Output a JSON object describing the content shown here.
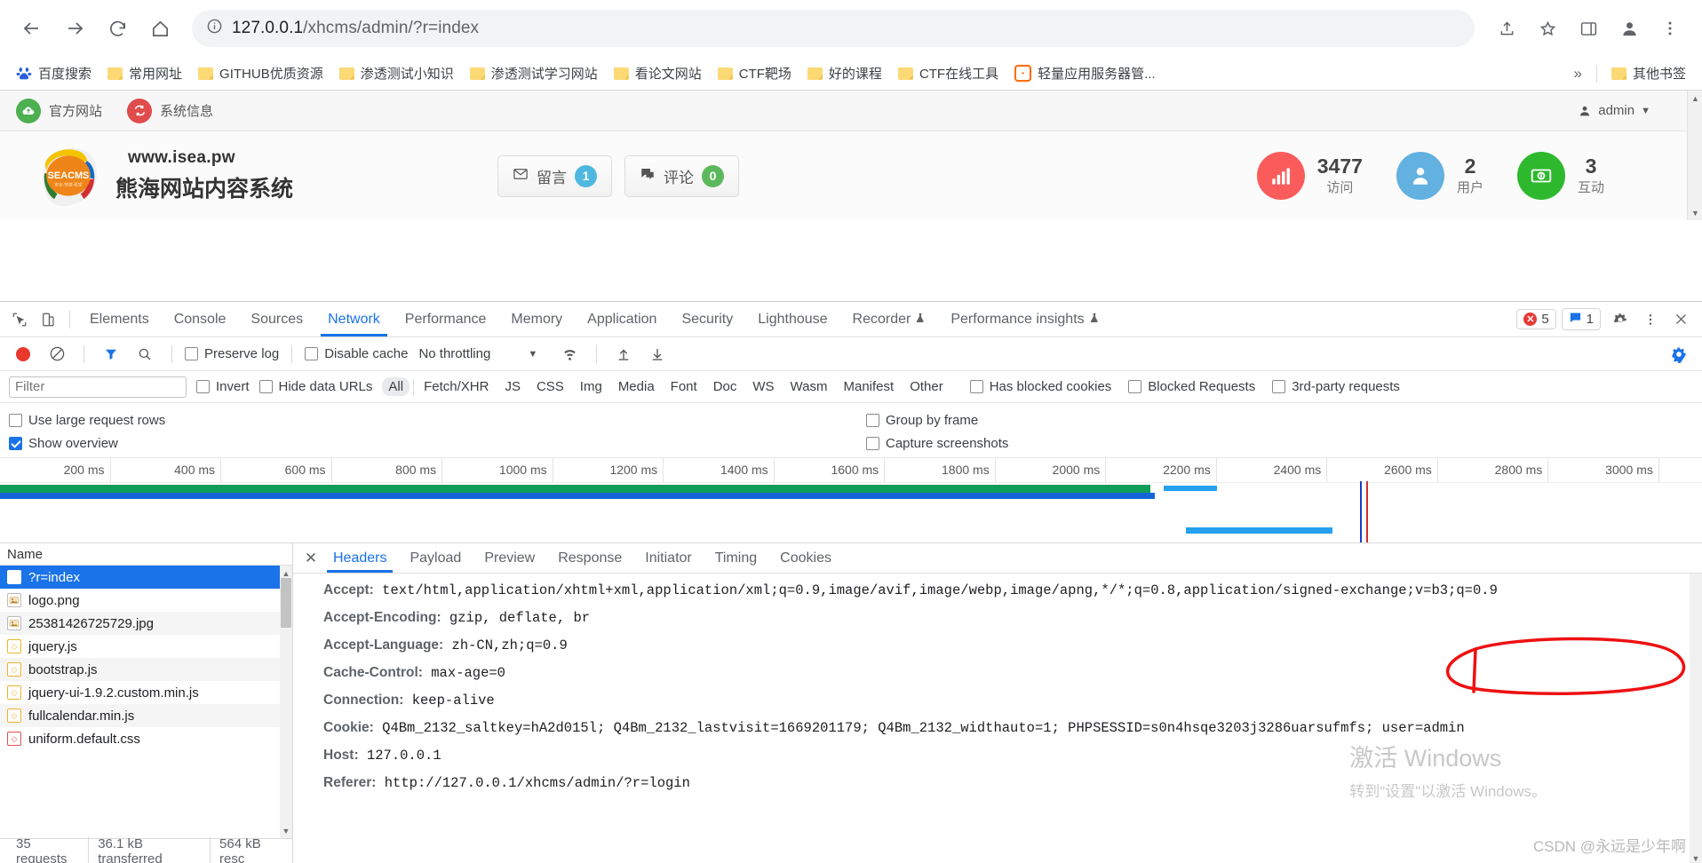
{
  "browser": {
    "url_host": "127.0.0.1",
    "url_path": "/xhcms/admin/?r=index",
    "back_icon": "back-arrow-icon",
    "forward_icon": "forward-arrow-icon",
    "reload_icon": "reload-icon",
    "home_icon": "home-icon",
    "info_icon": "site-info-icon",
    "share_icon": "share-icon",
    "star_icon": "bookmark-star-icon",
    "sidepanel_icon": "side-panel-icon",
    "profile_icon": "profile-avatar-icon",
    "menu_icon": "kebab-menu-icon"
  },
  "bookmarks": {
    "items": [
      {
        "label": "百度搜索",
        "icon": "baidu-icon"
      },
      {
        "label": "常用网址",
        "icon": "folder-icon"
      },
      {
        "label": "GITHUB优质资源",
        "icon": "folder-icon"
      },
      {
        "label": "渗透测试小知识",
        "icon": "folder-icon"
      },
      {
        "label": "渗透测试学习网站",
        "icon": "folder-icon"
      },
      {
        "label": "看论文网站",
        "icon": "folder-icon"
      },
      {
        "label": "CTF靶场",
        "icon": "folder-icon"
      },
      {
        "label": "好的课程",
        "icon": "folder-icon"
      },
      {
        "label": "CTF在线工具",
        "icon": "folder-icon"
      },
      {
        "label": "轻量应用服务器管...",
        "icon": "lighthouse-icon"
      }
    ],
    "overflow_label": "»",
    "other_label": "其他书签"
  },
  "cms": {
    "topbar": {
      "official_site": "官方网站",
      "system_info": "系统信息",
      "user": "admin"
    },
    "brand": {
      "logo_text": "SEACMS",
      "site_url": "www.isea.pw",
      "site_name": "熊海网站内容系统"
    },
    "msg_buttons": [
      {
        "label": "留言",
        "count": "1",
        "color": "#4fb8e0",
        "icon": "envelope-icon"
      },
      {
        "label": "评论",
        "count": "0",
        "color": "#5cb85c",
        "icon": "comment-icon"
      }
    ],
    "stats": [
      {
        "value": "3477",
        "label": "访问",
        "color": "#fa5c5c",
        "icon": "bar-chart-icon"
      },
      {
        "value": "2",
        "label": "用户",
        "color": "#62b1e0",
        "icon": "user-icon"
      },
      {
        "value": "3",
        "label": "互动",
        "color": "#2eb82e",
        "icon": "money-icon"
      }
    ]
  },
  "devtools": {
    "tabs": [
      {
        "label": "Elements",
        "active": false
      },
      {
        "label": "Console",
        "active": false
      },
      {
        "label": "Sources",
        "active": false
      },
      {
        "label": "Network",
        "active": true
      },
      {
        "label": "Performance",
        "active": false
      },
      {
        "label": "Memory",
        "active": false
      },
      {
        "label": "Application",
        "active": false
      },
      {
        "label": "Security",
        "active": false
      },
      {
        "label": "Lighthouse",
        "active": false
      },
      {
        "label": "Recorder",
        "active": false,
        "experiment": true
      },
      {
        "label": "Performance insights",
        "active": false,
        "experiment": true
      }
    ],
    "error_count": "5",
    "message_count": "1",
    "inspect_icon": "inspect-element-icon",
    "device_icon": "device-toolbar-icon",
    "settings_icon": "gear-icon",
    "more_icon": "kebab-menu-icon",
    "close_icon": "close-icon",
    "network_toolbar": {
      "record_icon": "record-icon",
      "clear_icon": "clear-icon",
      "filter_icon": "filter-icon",
      "search_icon": "search-icon",
      "preserve_log": "Preserve log",
      "preserve_log_checked": false,
      "disable_cache": "Disable cache",
      "disable_cache_checked": false,
      "throttling": "No throttling",
      "wifi_icon": "network-conditions-icon",
      "import_icon": "import-har-icon",
      "export_icon": "export-har-icon",
      "settings_icon": "gear-icon"
    },
    "filter_bar": {
      "placeholder": "Filter",
      "value": "",
      "invert": "Invert",
      "invert_checked": false,
      "hide_data_urls": "Hide data URLs",
      "hide_data_urls_checked": false,
      "types": [
        "All",
        "Fetch/XHR",
        "JS",
        "CSS",
        "Img",
        "Media",
        "Font",
        "Doc",
        "WS",
        "Wasm",
        "Manifest",
        "Other"
      ],
      "selected_type": "All",
      "has_blocked_cookies": "Has blocked cookies",
      "has_blocked_cookies_checked": false,
      "blocked_requests": "Blocked Requests",
      "blocked_requests_checked": false,
      "third_party": "3rd-party requests",
      "third_party_checked": false
    },
    "options": {
      "large_rows": "Use large request rows",
      "large_rows_checked": false,
      "show_overview": "Show overview",
      "show_overview_checked": true,
      "group_by_frame": "Group by frame",
      "group_by_frame_checked": false,
      "capture_screenshots": "Capture screenshots",
      "capture_screenshots_checked": false
    },
    "overview_ticks": [
      "200 ms",
      "400 ms",
      "600 ms",
      "800 ms",
      "1000 ms",
      "1200 ms",
      "1400 ms",
      "1600 ms",
      "1800 ms",
      "2000 ms",
      "2200 ms",
      "2400 ms",
      "2600 ms",
      "2800 ms",
      "3000 ms"
    ],
    "requests": {
      "column_header": "Name",
      "rows": [
        {
          "name": "?r=index",
          "type": "doc",
          "selected": true
        },
        {
          "name": "logo.png",
          "type": "img",
          "selected": false
        },
        {
          "name": "25381426725729.jpg",
          "type": "img",
          "selected": false
        },
        {
          "name": "jquery.js",
          "type": "js",
          "selected": false
        },
        {
          "name": "bootstrap.js",
          "type": "js",
          "selected": false
        },
        {
          "name": "jquery-ui-1.9.2.custom.min.js",
          "type": "js",
          "selected": false
        },
        {
          "name": "fullcalendar.min.js",
          "type": "js",
          "selected": false
        },
        {
          "name": "uniform.default.css",
          "type": "css",
          "selected": false
        }
      ]
    },
    "summary": {
      "requests": "35 requests",
      "transferred": "36.1 kB transferred",
      "resources": "564 kB resc"
    },
    "detail_tabs": [
      {
        "label": "Headers",
        "active": true
      },
      {
        "label": "Payload",
        "active": false
      },
      {
        "label": "Preview",
        "active": false
      },
      {
        "label": "Response",
        "active": false
      },
      {
        "label": "Initiator",
        "active": false
      },
      {
        "label": "Timing",
        "active": false
      },
      {
        "label": "Cookies",
        "active": false
      }
    ],
    "headers": [
      {
        "key": "Accept:",
        "value": "text/html,application/xhtml+xml,application/xml;q=0.9,image/avif,image/webp,image/apng,*/*;q=0.8,application/signed-exchange;v=b3;q=0.9"
      },
      {
        "key": "Accept-Encoding:",
        "value": "gzip, deflate, br"
      },
      {
        "key": "Accept-Language:",
        "value": "zh-CN,zh;q=0.9"
      },
      {
        "key": "Cache-Control:",
        "value": "max-age=0"
      },
      {
        "key": "Connection:",
        "value": "keep-alive"
      },
      {
        "key": "Cookie:",
        "value": "Q4Bm_2132_saltkey=hA2d015l; Q4Bm_2132_lastvisit=1669201179; Q4Bm_2132_widthauto=1; PHPSESSID=s0n4hsqe3203j3286uarsufmfs; user=admin"
      },
      {
        "key": "Host:",
        "value": "127.0.0.1"
      },
      {
        "key": "Referer:",
        "value": "http://127.0.0.1/xhcms/admin/?r=login"
      }
    ]
  },
  "watermarks": {
    "windows_line1": "激活 Windows",
    "windows_line2": "转到\"设置\"以激活 Windows。",
    "csdn": "CSDN @永远是少年啊"
  }
}
